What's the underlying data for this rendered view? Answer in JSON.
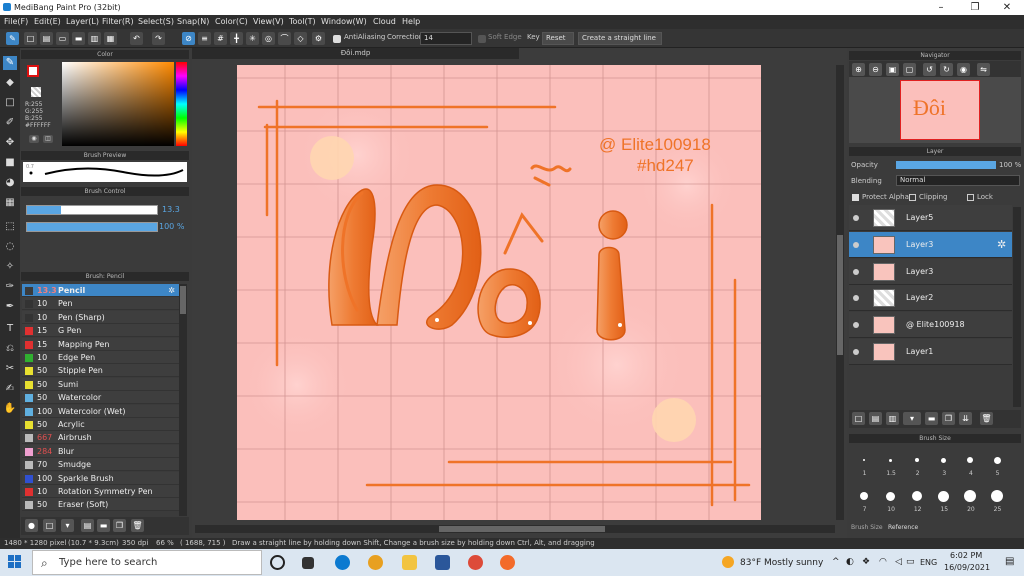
{
  "window": {
    "title": "MediBang Paint Pro (32bit)",
    "minimize": "–",
    "maximize": "❐",
    "close": "✕"
  },
  "menu": [
    "File(F)",
    "Edit(E)",
    "Layer(L)",
    "Filter(R)",
    "Select(S)",
    "Snap(N)",
    "Color(C)",
    "View(V)",
    "Tool(T)",
    "Window(W)",
    "Cloud",
    "Help"
  ],
  "toolbar": {
    "antialiasing": "AntiAliasing",
    "correction_label": "Correction",
    "correction_value": "14",
    "soft_edge": "Soft Edge",
    "key": "Key",
    "reset": "Reset",
    "straight_line": "Create a straight line"
  },
  "color_panel": {
    "title": "Color",
    "r": "R:255",
    "g": "G:255",
    "b": "B:255",
    "hex": "#FFFFFF"
  },
  "brush_preview": {
    "title": "Brush Preview",
    "size": "0.7"
  },
  "brush_control": {
    "title": "Brush Control",
    "size_value": "13.3",
    "opacity_value": "100 %",
    "size_fraction": 0.26,
    "opacity_fraction": 1.0
  },
  "brush_panel": {
    "title": "Brush: Pencil",
    "items": [
      {
        "size": "13.3",
        "name": "Pencil",
        "color": "#3b3b3b",
        "selected": true
      },
      {
        "size": "10",
        "name": "Pen",
        "color": "#333333"
      },
      {
        "size": "10",
        "name": "Pen (Sharp)",
        "color": "#333333"
      },
      {
        "size": "15",
        "name": "G Pen",
        "color": "#e03030"
      },
      {
        "size": "15",
        "name": "Mapping Pen",
        "color": "#e03030"
      },
      {
        "size": "10",
        "name": "Edge Pen",
        "color": "#30b030"
      },
      {
        "size": "50",
        "name": "Stipple Pen",
        "color": "#e8e030"
      },
      {
        "size": "50",
        "name": "Sumi",
        "color": "#e8e030"
      },
      {
        "size": "50",
        "name": "Watercolor",
        "color": "#60b0e0"
      },
      {
        "size": "100",
        "name": "Watercolor (Wet)",
        "color": "#60b0e0"
      },
      {
        "size": "50",
        "name": "Acrylic",
        "color": "#e8e030"
      },
      {
        "size": "667",
        "name": "Airbrush",
        "color": "#bbbbbb",
        "size_color": "#e05050"
      },
      {
        "size": "284",
        "name": "Blur",
        "color": "#f0a0d0",
        "size_color": "#e05050"
      },
      {
        "size": "70",
        "name": "Smudge",
        "color": "#bbbbbb"
      },
      {
        "size": "100",
        "name": "Sparkle Brush",
        "color": "#3050d0"
      },
      {
        "size": "10",
        "name": "Rotation Symmetry Pen",
        "color": "#e03030"
      },
      {
        "size": "50",
        "name": "Eraser (Soft)",
        "color": "#bbbbbb"
      }
    ]
  },
  "document": {
    "tab": "Đôi.mdp"
  },
  "artwork": {
    "watermark_line1": "@ Elite100918",
    "watermark_line2": "#hd247",
    "word": "Đôi"
  },
  "navigator": {
    "title": "Navigator"
  },
  "layer_panel": {
    "title": "Layer",
    "opacity_label": "Opacity",
    "opacity_value": "100 %",
    "blending_label": "Blending",
    "blending_value": "Normal",
    "protect_alpha": "Protect Alpha",
    "clipping": "Clipping",
    "lock": "Lock",
    "layers": [
      {
        "name": "Layer5",
        "selected": false
      },
      {
        "name": "Layer3",
        "selected": true
      },
      {
        "name": "Layer3",
        "selected": false
      },
      {
        "name": "Layer2",
        "selected": false
      },
      {
        "name": "@ Elite100918",
        "selected": false
      },
      {
        "name": "Layer1",
        "selected": false
      }
    ]
  },
  "brush_size_panel": {
    "title": "Brush Size",
    "row1": [
      "1",
      "1.5",
      "2",
      "3",
      "4",
      "5"
    ],
    "row2": [
      "7",
      "10",
      "12",
      "15",
      "20",
      "25"
    ],
    "tabs": [
      "Brush Size",
      "Reference"
    ]
  },
  "status": {
    "dimensions": "1480 * 1280 pixel",
    "physical": "(10.7 * 9.3cm)",
    "dpi": "350 dpi",
    "zoom": "66 %",
    "cursor": "( 1688, 715 )",
    "hint": "Draw a straight line by holding down Shift, Change a brush size by holding down Ctrl, Alt, and dragging"
  },
  "taskbar": {
    "search_placeholder": "Type here to search",
    "weather": "83°F  Mostly sunny",
    "lang": "ENG",
    "time": "6:02 PM",
    "date": "16/09/2021"
  }
}
